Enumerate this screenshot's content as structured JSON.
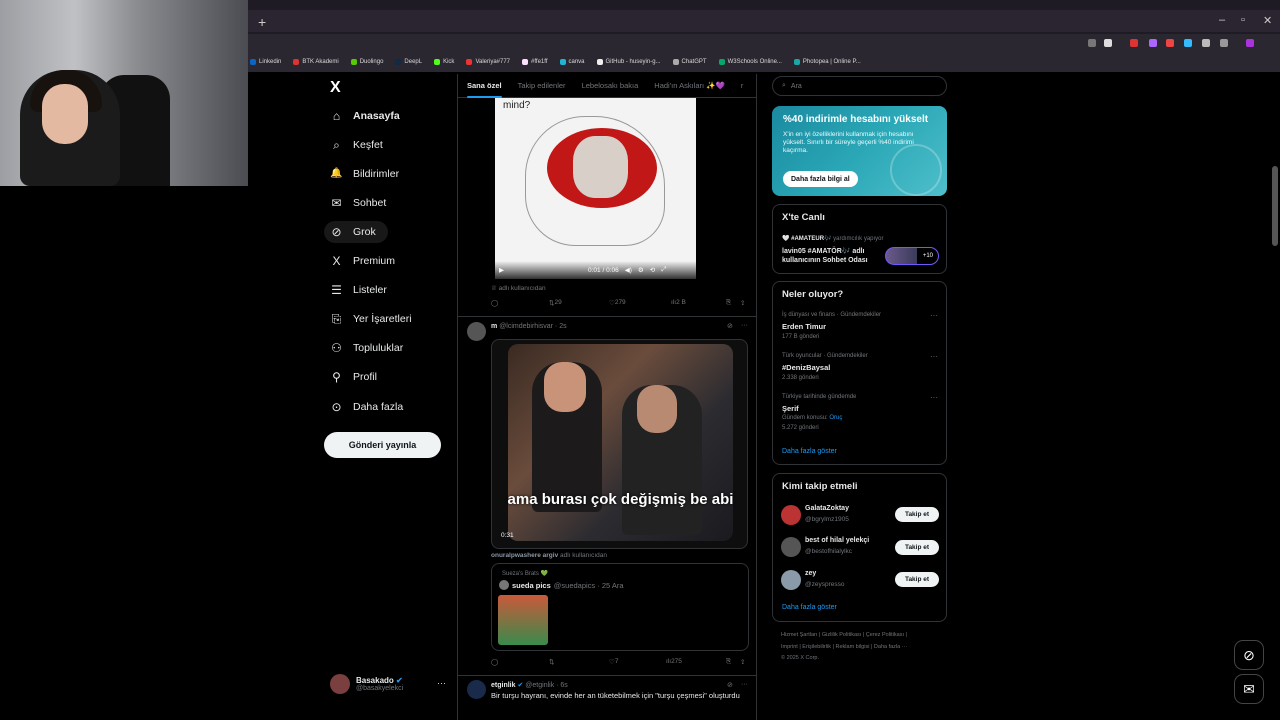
{
  "browser": {
    "new_tab": "+",
    "win_min": "–",
    "win_max": "▫",
    "win_close": "✕",
    "bookmarks": [
      "Linkedin",
      "BTK Akademi",
      "Duolingo",
      "DeepL",
      "Kick",
      "Valeriya#777",
      "#ffe1ff",
      "canva",
      "GitHub - huseyin-g...",
      "ChatGPT",
      "W3Schools Online...",
      "Photopea | Online P..."
    ]
  },
  "nav": {
    "items": [
      {
        "label": "Anasayfa",
        "icon": "home-icon",
        "glyph": "⌂"
      },
      {
        "label": "Keşfet",
        "icon": "search-icon",
        "glyph": "⌕"
      },
      {
        "label": "Bildirimler",
        "icon": "bell-icon",
        "glyph": "🔔"
      },
      {
        "label": "Sohbet",
        "icon": "mail-icon",
        "glyph": "✉"
      },
      {
        "label": "Grok",
        "icon": "grok-icon",
        "glyph": "⊘"
      },
      {
        "label": "Premium",
        "icon": "x-icon",
        "glyph": "X"
      },
      {
        "label": "Listeler",
        "icon": "list-icon",
        "glyph": "☰"
      },
      {
        "label": "Yer İşaretleri",
        "icon": "bookmark-icon",
        "glyph": "⎘"
      },
      {
        "label": "Topluluklar",
        "icon": "people-icon",
        "glyph": "⚇"
      },
      {
        "label": "Profil",
        "icon": "person-icon",
        "glyph": "⚲"
      },
      {
        "label": "Daha fazla",
        "icon": "more-icon",
        "glyph": "⊙"
      }
    ],
    "post_button": "Gönderi yayınla",
    "profile": {
      "name": "Basakado",
      "handle": "@basakyelekci",
      "more": "···"
    }
  },
  "feed": {
    "tabs": [
      "Sana özel",
      "Takip edilenler",
      "Lebelosakı bakıa",
      "Hadi'ın Askıları ✨💜",
      "r"
    ],
    "post1": {
      "caption": "mind?",
      "time": "0:01 / 0:06",
      "via": "adlı kullanıcıdan",
      "reposts": "29",
      "likes": "279",
      "views": "2 B"
    },
    "post2": {
      "name": "m",
      "handle": "@lcimdebirhisvar · 2s",
      "subtitle": "ama burası çok değişmiş be abi",
      "time": "0:31",
      "via_user": "onuralpwashere argiv",
      "via": "adlı kullanıcıdan",
      "quote_top": "Sueza's Brats 💚",
      "quote_name": "sueda pics",
      "quote_handle": "@suedapics · 25 Ara",
      "likes": "7",
      "views": "275"
    },
    "post3": {
      "name": "etginlik",
      "handle": "@etginlik · 6s",
      "text": "Bir turşu hayranı, evinde her an tüketebilmek için \"turşu çeşmesi\" oluşturdu"
    }
  },
  "right": {
    "search_placeholder": "Ara",
    "promo": {
      "title": "%40 indirimle hesabını yükselt",
      "desc": "X'in en iyi özelliklerini kullanmak için hesabını yükselt. Sınırlı bir süreyle geçerli %40 indirimi kaçırma.",
      "button": "Daha fazla bilgi al"
    },
    "live": {
      "title": "X'te Canlı",
      "host": "🤍 #AMATEUR🎶",
      "host_role": "yardımcılık yapıyor",
      "line": "lavin05 #AMATÖR🎶 adlı kullanıcının Sohbet Odası",
      "count": "+10"
    },
    "trends": {
      "title": "Neler oluyor?",
      "items": [
        {
          "cat": "İş dünyası ve finans · Gündemdekiler",
          "name": "Erden Timur",
          "count": "177 B gönderi"
        },
        {
          "cat": "Türk oyuncular · Gündemdekiler",
          "name": "#DenizBaysal",
          "count": "2.338 gönderi"
        },
        {
          "cat": "Türkiye tarihinde gündemde",
          "name": "Şerif",
          "extra": "Gündem konusu:",
          "extra_link": "Oruç",
          "count": "5.272 gönderi"
        }
      ],
      "show_more": "Daha fazla göster"
    },
    "who": {
      "title": "Kimi takip etmeli",
      "items": [
        {
          "name": "GalataZoktay",
          "handle": "@bgrylmz1905",
          "button": "Takip et"
        },
        {
          "name": "best of hilal yelekçi",
          "handle": "@bestofhilalylkc",
          "button": "Takip et"
        },
        {
          "name": "zey",
          "handle": "@zeyspresso",
          "button": "Takip et"
        }
      ],
      "show_more": "Daha fazla göster"
    },
    "footer": {
      "line1": "Hizmet Şartları  |  Gizlilik Politikası  |  Çerez Politikası  |",
      "line2": "Imprint  |  Erişilebilirlik  |  Reklam bilgisi  |  Daha fazla ···",
      "line3": "© 2025 X Corp."
    }
  },
  "colors": {
    "accent": "#1d9bf0",
    "background": "#000000",
    "border": "#2f3336",
    "muted": "#71767b"
  }
}
